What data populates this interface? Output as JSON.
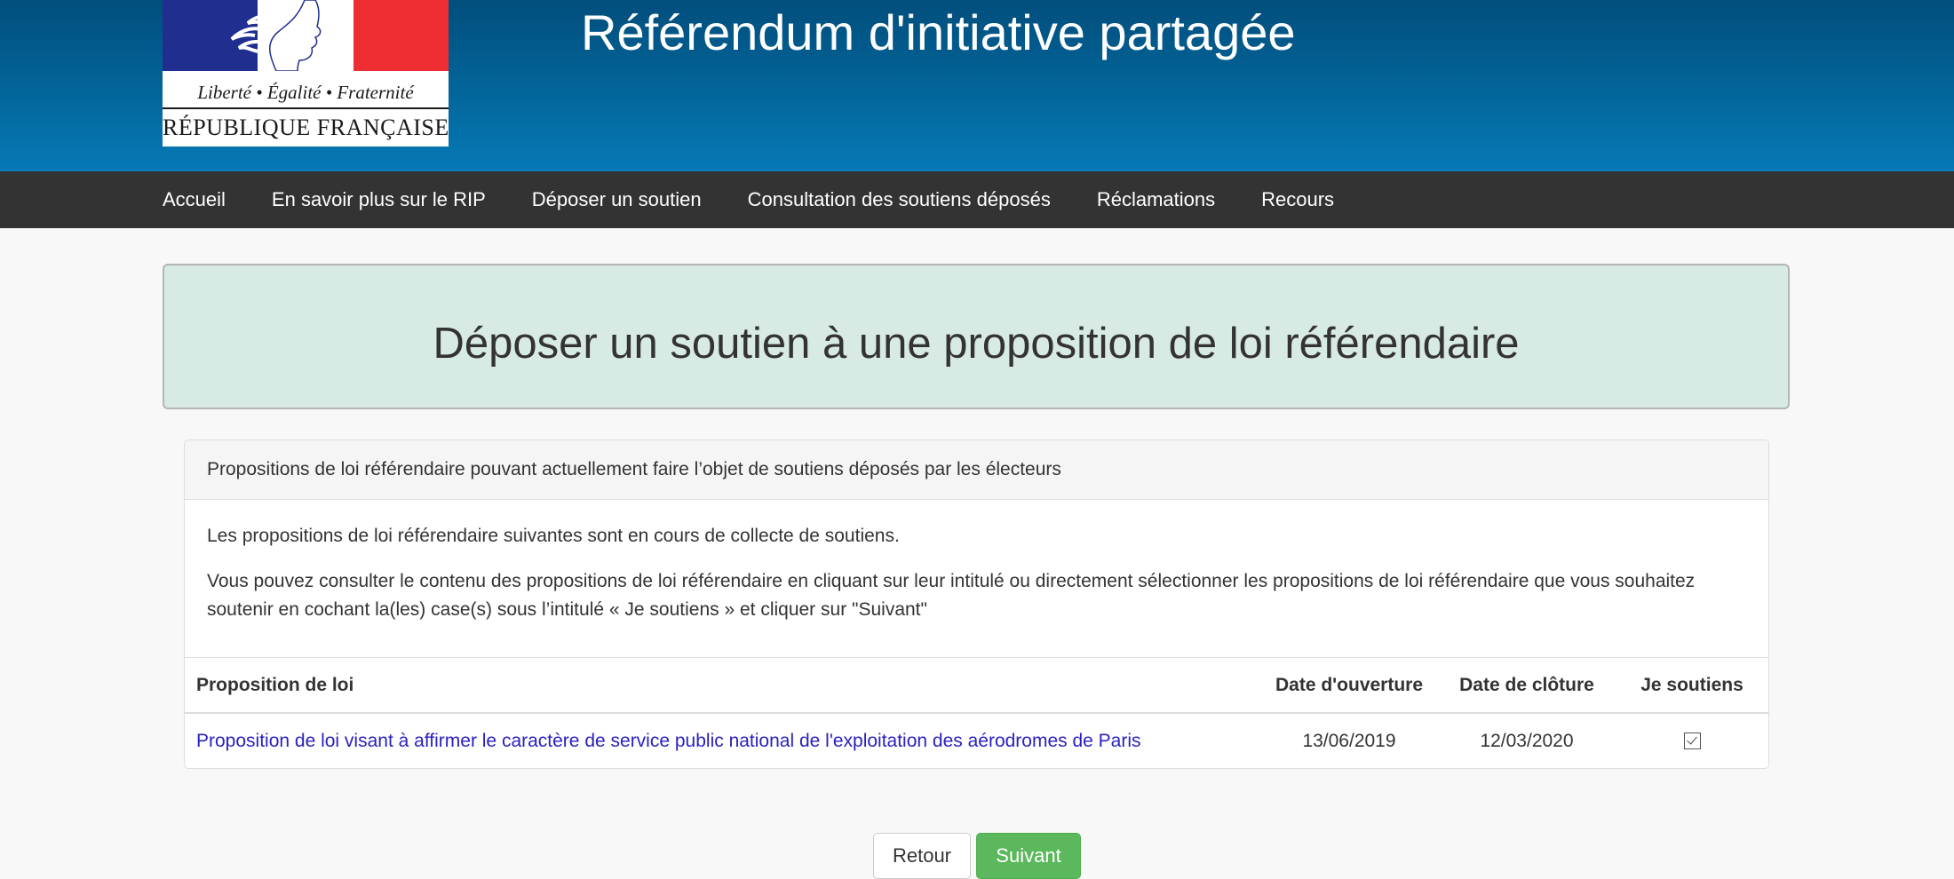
{
  "header": {
    "logo": {
      "motto": "Liberté • Égalité • Fraternité",
      "republic": "RÉPUBLIQUE FRANÇAISE",
      "flag_colors": [
        "#1f2e8f",
        "#ffffff",
        "#ee2e33"
      ]
    },
    "title": "Référendum d'initiative partagée"
  },
  "nav": {
    "items": [
      {
        "label": "Accueil"
      },
      {
        "label": "En savoir plus sur le RIP"
      },
      {
        "label": "Déposer un soutien"
      },
      {
        "label": "Consultation des soutiens déposés"
      },
      {
        "label": "Réclamations"
      },
      {
        "label": "Recours"
      }
    ]
  },
  "main": {
    "heading": "Déposer un soutien à une proposition de loi référendaire",
    "panel": {
      "title": "Propositions de loi référendaire pouvant actuellement faire l’objet de soutiens déposés par les électeurs",
      "intro1": "Les propositions de loi référendaire suivantes sont en cours de collecte de soutiens.",
      "intro2": "Vous pouvez consulter le contenu des propositions de loi référendaire en cliquant sur leur intitulé ou directement sélectionner les propositions de loi référendaire que vous souhaitez soutenir en cochant la(les) case(s) sous l’intitulé « Je soutiens » et cliquer sur \"Suivant\"",
      "table": {
        "headers": [
          "Proposition de loi",
          "Date d'ouverture",
          "Date de clôture",
          "Je soutiens"
        ],
        "rows": [
          {
            "proposition": "Proposition de loi visant à affirmer le caractère de service public national de l'exploitation des aérodromes de Paris",
            "date_ouverture": "13/06/2019",
            "date_cloture": "12/03/2020",
            "je_soutiens_checked": true
          }
        ]
      }
    },
    "buttons": {
      "back": "Retour",
      "next": "Suivant"
    }
  },
  "colors": {
    "header_gradient": [
      "#024e7c",
      "#0679b6"
    ],
    "navbar": "#333333",
    "jumbotron": "#d7eae4",
    "link": "#2a21c0",
    "primary_button": "#5cb85c"
  }
}
